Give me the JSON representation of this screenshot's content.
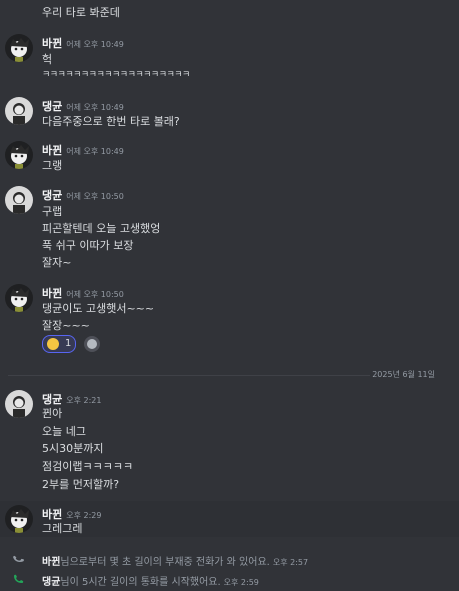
{
  "top_message": "우리 타로 봐준데",
  "messages": [
    {
      "author": "바뀐",
      "time": "어제 오후 10:49",
      "lines": [
        "헉",
        "ㅋㅋㅋㅋㅋㅋㅋㅋㅋㅋㅋㅋㅋㅋㅋㅋㅋㅋㅋ"
      ]
    },
    {
      "author": "댕균",
      "time": "어제 오후 10:49",
      "lines": [
        "다음주중으로 한번 타로 볼래?"
      ]
    },
    {
      "author": "바뀐",
      "time": "어제 오후 10:49",
      "lines": [
        "그랭"
      ]
    },
    {
      "author": "댕균",
      "time": "어제 오후 10:50",
      "lines": [
        "구랩",
        "피곤할텐데 오늘 고생했엉",
        "푹 쉬구 이따가 보장",
        "잘자~"
      ]
    },
    {
      "author": "바뀐",
      "time": "어제 오후 10:50",
      "lines": [
        "댕균이도 고생햇서~~~",
        "잘장~~~"
      ]
    },
    {
      "author": "댕균",
      "time": "오후 2:21",
      "lines": [
        "뀐아",
        "오늘 네그",
        "5시30분까지",
        "점검이랩ㅋㅋㅋㅋㅋ",
        "2부를 먼저할까?"
      ]
    },
    {
      "author": "바뀐",
      "time": "오후 2:29",
      "lines": [
        "그레그레"
      ]
    }
  ],
  "reaction": {
    "count": "1"
  },
  "date_divider": "2025년 6월 11일",
  "system": [
    {
      "name": "바뀐",
      "text": "님으로부터 몇 초 길이의 부재중 전화가 와 있어요.",
      "time": "오후 2:57",
      "icon": "phone-missed-icon"
    },
    {
      "name": "댕균",
      "text": "님이 5시간 길이의 통화를 시작했어요.",
      "time": "오후 2:59",
      "icon": "phone-icon"
    }
  ],
  "colors": {
    "background": "#313338",
    "accent": "#5865f2",
    "call_green": "#23a559"
  }
}
